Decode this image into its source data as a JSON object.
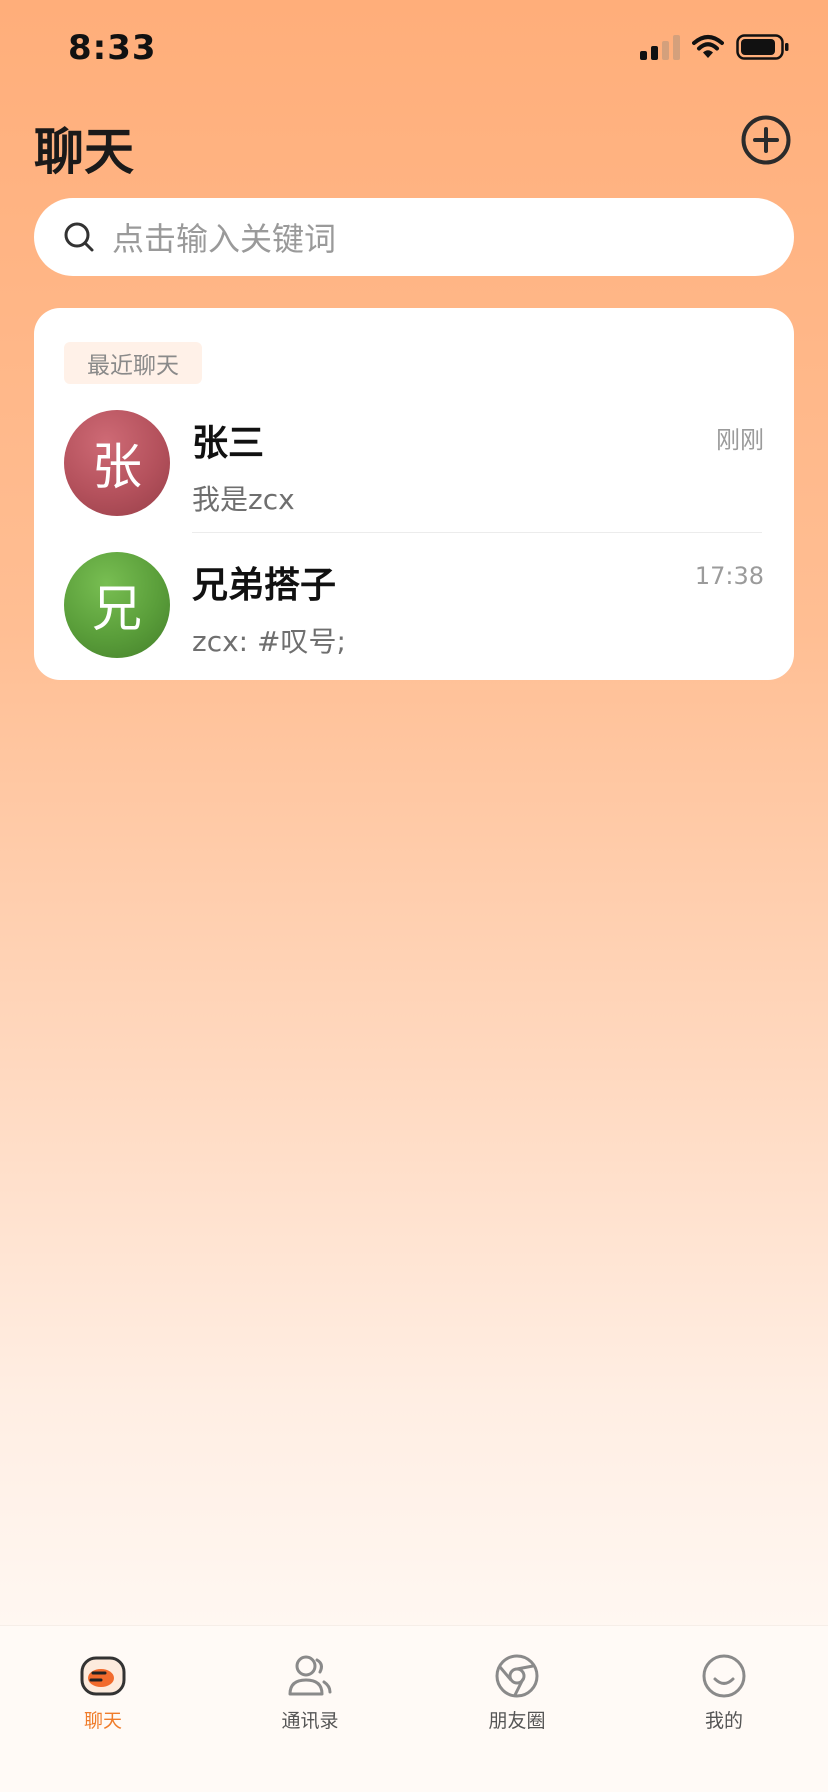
{
  "status_bar": {
    "time": "8:33"
  },
  "header": {
    "title": "聊天"
  },
  "search": {
    "placeholder": "点击输入关键词"
  },
  "recent": {
    "tag": "最近聊天",
    "chats": [
      {
        "avatar_char": "张",
        "avatar_color": "#B4515C",
        "name": "张三",
        "time": "刚刚",
        "preview": "我是zcx"
      },
      {
        "avatar_char": "兄",
        "avatar_color": "#5A9E3A",
        "name": "兄弟搭子",
        "time": "17:38",
        "preview": "zcx: #叹号;"
      }
    ]
  },
  "tabs": [
    {
      "label": "聊天",
      "icon": "chat-icon",
      "active": true
    },
    {
      "label": "通讯录",
      "icon": "contacts-icon",
      "active": false
    },
    {
      "label": "朋友圈",
      "icon": "moments-icon",
      "active": false
    },
    {
      "label": "我的",
      "icon": "profile-icon",
      "active": false
    }
  ],
  "colors": {
    "accent": "#F07C2A",
    "background_top": "#FFAE7A",
    "background_bottom": "#FFFBF8"
  }
}
